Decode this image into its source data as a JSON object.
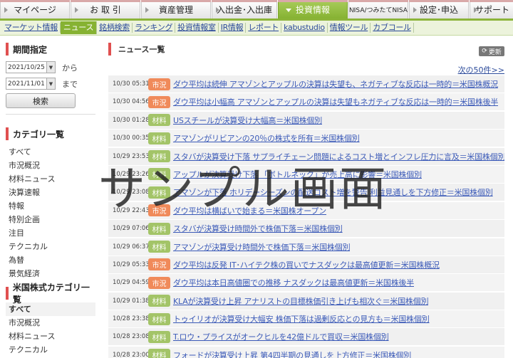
{
  "topnav": [
    {
      "label": "マイページ",
      "active": false,
      "width": 98
    },
    {
      "label": "お 取 引",
      "active": false,
      "width": 98
    },
    {
      "label": "資産管理",
      "active": false,
      "width": 98
    },
    {
      "label": "入出金･入出庫",
      "active": false,
      "width": 92
    },
    {
      "label": "投資情報",
      "active": true,
      "width": 98
    },
    {
      "label": "NISA/つみたてNISA",
      "active": false,
      "width": 84
    },
    {
      "label": "設定･申込",
      "active": false,
      "width": 84
    },
    {
      "label": "サポート",
      "active": false,
      "width": 64
    }
  ],
  "subnav": [
    {
      "label": "マーケット情報",
      "active": false
    },
    {
      "label": "ニュース",
      "active": true
    },
    {
      "label": "銘柄検索",
      "active": false
    },
    {
      "label": "ランキング",
      "active": false
    },
    {
      "label": "投資情報室",
      "active": false
    },
    {
      "label": "IR情報",
      "active": false
    },
    {
      "label": "レポート",
      "active": false
    },
    {
      "label": "kabustudio",
      "active": false
    },
    {
      "label": "情報ツール",
      "active": false
    },
    {
      "label": "カブコール",
      "active": false
    }
  ],
  "sidebar": {
    "period_title": "期間指定",
    "from_date": "2021/10/25",
    "from_suffix": "から",
    "to_date": "2021/11/01",
    "to_suffix": "まで",
    "search_label": "検索",
    "category_title": "カテゴリ一覧",
    "categories": [
      "すべて",
      "市況概況",
      "材料ニュース",
      "決算速報",
      "特報",
      "特別企画",
      "注目",
      "テクニカル",
      "為替",
      "景気経済"
    ],
    "us_category_title": "米国株式カテゴリ一覧",
    "us_categories": [
      "すべて",
      "市況概況",
      "材料ニュース",
      "テクニカル"
    ],
    "us_selected": 0
  },
  "main": {
    "title": "ニュース一覧",
    "refresh_label": "更新",
    "next_label": "次の50件>>",
    "news": [
      {
        "time": "10/30 05:31",
        "type": "market",
        "badge": "市況",
        "title": "ダウ平均は続伸 アマゾンとアップルの決算は失望も、ネガティブな反応は一時的＝米国株概況"
      },
      {
        "time": "10/30 04:56",
        "type": "market",
        "badge": "市況",
        "title": "ダウ平均は小幅高 アマゾンとアップルの決算は失望もネガティブな反応は一時的＝米国株後半"
      },
      {
        "time": "10/30 01:28",
        "type": "material",
        "badge": "材料",
        "title": "USスチールが決算受け大幅高＝米国株個別"
      },
      {
        "time": "10/30 00:35",
        "type": "material",
        "badge": "材料",
        "title": "アマゾンがリビアンの20％の株式を所有＝米国株個別"
      },
      {
        "time": "10/29 23:53",
        "type": "material",
        "badge": "材料",
        "title": "スタバが決算受け下落 サプライチェーン問題によるコスト増とインフレ圧力に言及＝米国株個別"
      },
      {
        "time": "10/29 23:26",
        "type": "material",
        "badge": "材料",
        "title": "アップルが決算受け下落 「ボトルネック」が売上高に影響＝米国株個別"
      },
      {
        "time": "10/29 23:08",
        "type": "material",
        "badge": "材料",
        "title": "アマゾンが下落 ホリデーシーズンの配送コスト増を警告 利益見通しを下方修正＝米国株個別"
      },
      {
        "time": "10/29 22:43",
        "type": "market",
        "badge": "市況",
        "title": "ダウ平均は横ばいで始まる＝米国株オープン"
      },
      {
        "time": "10/29 07:06",
        "type": "material",
        "badge": "材料",
        "title": "スタバが決算受け時間外で株価下落＝米国株個別"
      },
      {
        "time": "10/29 06:37",
        "type": "material",
        "badge": "材料",
        "title": "アマゾンが決算受け時間外で株価下落＝米国株個別"
      },
      {
        "time": "10/29 05:33",
        "type": "market",
        "badge": "市況",
        "title": "ダウ平均は反発 IT･ハイテク株の買いでナスダックは最高値更新＝米国株概況"
      },
      {
        "time": "10/29 04:59",
        "type": "market",
        "badge": "市況",
        "title": "ダウ平均は本日高値圏での推移 ナスダックは最高値更新＝米国株後半"
      },
      {
        "time": "10/29 01:38",
        "type": "material",
        "badge": "材料",
        "title": "KLAが決算受け上昇 アナリストの目標株価引き上げも相次ぐ＝米国株個別"
      },
      {
        "time": "10/28 23:38",
        "type": "material",
        "badge": "材料",
        "title": "トゥイリオが決算受け大幅安 株価下落は過剰反応との見方も＝米国株個別"
      },
      {
        "time": "10/28 23:08",
        "type": "material",
        "badge": "材料",
        "title": "T.ロウ・プライスがオークヒルを42億ドルで買収＝米国株個別"
      },
      {
        "time": "10/28 23:00",
        "type": "material",
        "badge": "材料",
        "title": "フォードが決算受け上昇 第4四半期の見通しを上方修正＝米国株個別"
      }
    ]
  },
  "watermark": "サンプル画面",
  "colors": {
    "accent_green": "#86b232",
    "market_badge": "#f08a5a",
    "material_badge": "#a3c468",
    "section_bar": "#e05050",
    "link": "#3b5ab8"
  }
}
